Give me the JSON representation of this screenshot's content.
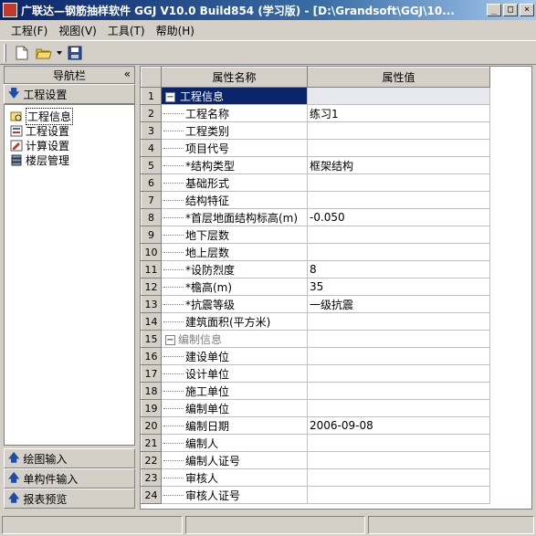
{
  "window": {
    "title": "广联达—钢筋抽样软件 GGJ V10.0 Build854 (学习版) - [D:\\Grandsoft\\GGJ\\10...",
    "buttons": {
      "minimize": "_",
      "maximize": "□",
      "close": "×"
    }
  },
  "menu": [
    "工程(F)",
    "视图(V)",
    "工具(T)",
    "帮助(H)"
  ],
  "toolbar": {
    "icons": [
      "new-file-icon",
      "open-folder-icon",
      "save-icon"
    ]
  },
  "nav": {
    "title": "导航栏",
    "collapse": "«",
    "section_top": "工程设置",
    "tree": [
      {
        "label": "工程信息",
        "icon": "project-info-icon",
        "selected": true
      },
      {
        "label": "工程设置",
        "icon": "project-settings-icon",
        "selected": false
      },
      {
        "label": "计算设置",
        "icon": "calc-settings-icon",
        "selected": false
      },
      {
        "label": "楼层管理",
        "icon": "floor-manage-icon",
        "selected": false
      }
    ],
    "sections_bottom": [
      "绘图输入",
      "单构件输入",
      "报表预览"
    ]
  },
  "grid": {
    "headers": [
      "属性名称",
      "属性值"
    ],
    "rows": [
      {
        "num": "1",
        "name": "工程信息",
        "value": "",
        "group": true
      },
      {
        "num": "2",
        "name": "工程名称",
        "value": "练习1"
      },
      {
        "num": "3",
        "name": "工程类别",
        "value": ""
      },
      {
        "num": "4",
        "name": "项目代号",
        "value": ""
      },
      {
        "num": "5",
        "name": "*结构类型",
        "value": "框架结构"
      },
      {
        "num": "6",
        "name": "基础形式",
        "value": ""
      },
      {
        "num": "7",
        "name": "结构特征",
        "value": ""
      },
      {
        "num": "8",
        "name": "*首层地面结构标高(m)",
        "value": "-0.050"
      },
      {
        "num": "9",
        "name": "地下层数",
        "value": ""
      },
      {
        "num": "10",
        "name": "地上层数",
        "value": ""
      },
      {
        "num": "11",
        "name": "*设防烈度",
        "value": "8"
      },
      {
        "num": "12",
        "name": "*檐高(m)",
        "value": "35"
      },
      {
        "num": "13",
        "name": "*抗震等级",
        "value": "一级抗震"
      },
      {
        "num": "14",
        "name": "建筑面积(平方米)",
        "value": ""
      },
      {
        "num": "15",
        "name": "编制信息",
        "value": "",
        "group": true
      },
      {
        "num": "16",
        "name": "建设单位",
        "value": ""
      },
      {
        "num": "17",
        "name": "设计单位",
        "value": ""
      },
      {
        "num": "18",
        "name": "施工单位",
        "value": ""
      },
      {
        "num": "19",
        "name": "编制单位",
        "value": ""
      },
      {
        "num": "20",
        "name": "编制日期",
        "value": "2006-09-08"
      },
      {
        "num": "21",
        "name": "编制人",
        "value": ""
      },
      {
        "num": "22",
        "name": "编制人证号",
        "value": ""
      },
      {
        "num": "23",
        "name": "审核人",
        "value": ""
      },
      {
        "num": "24",
        "name": "审核人证号",
        "value": ""
      }
    ]
  }
}
